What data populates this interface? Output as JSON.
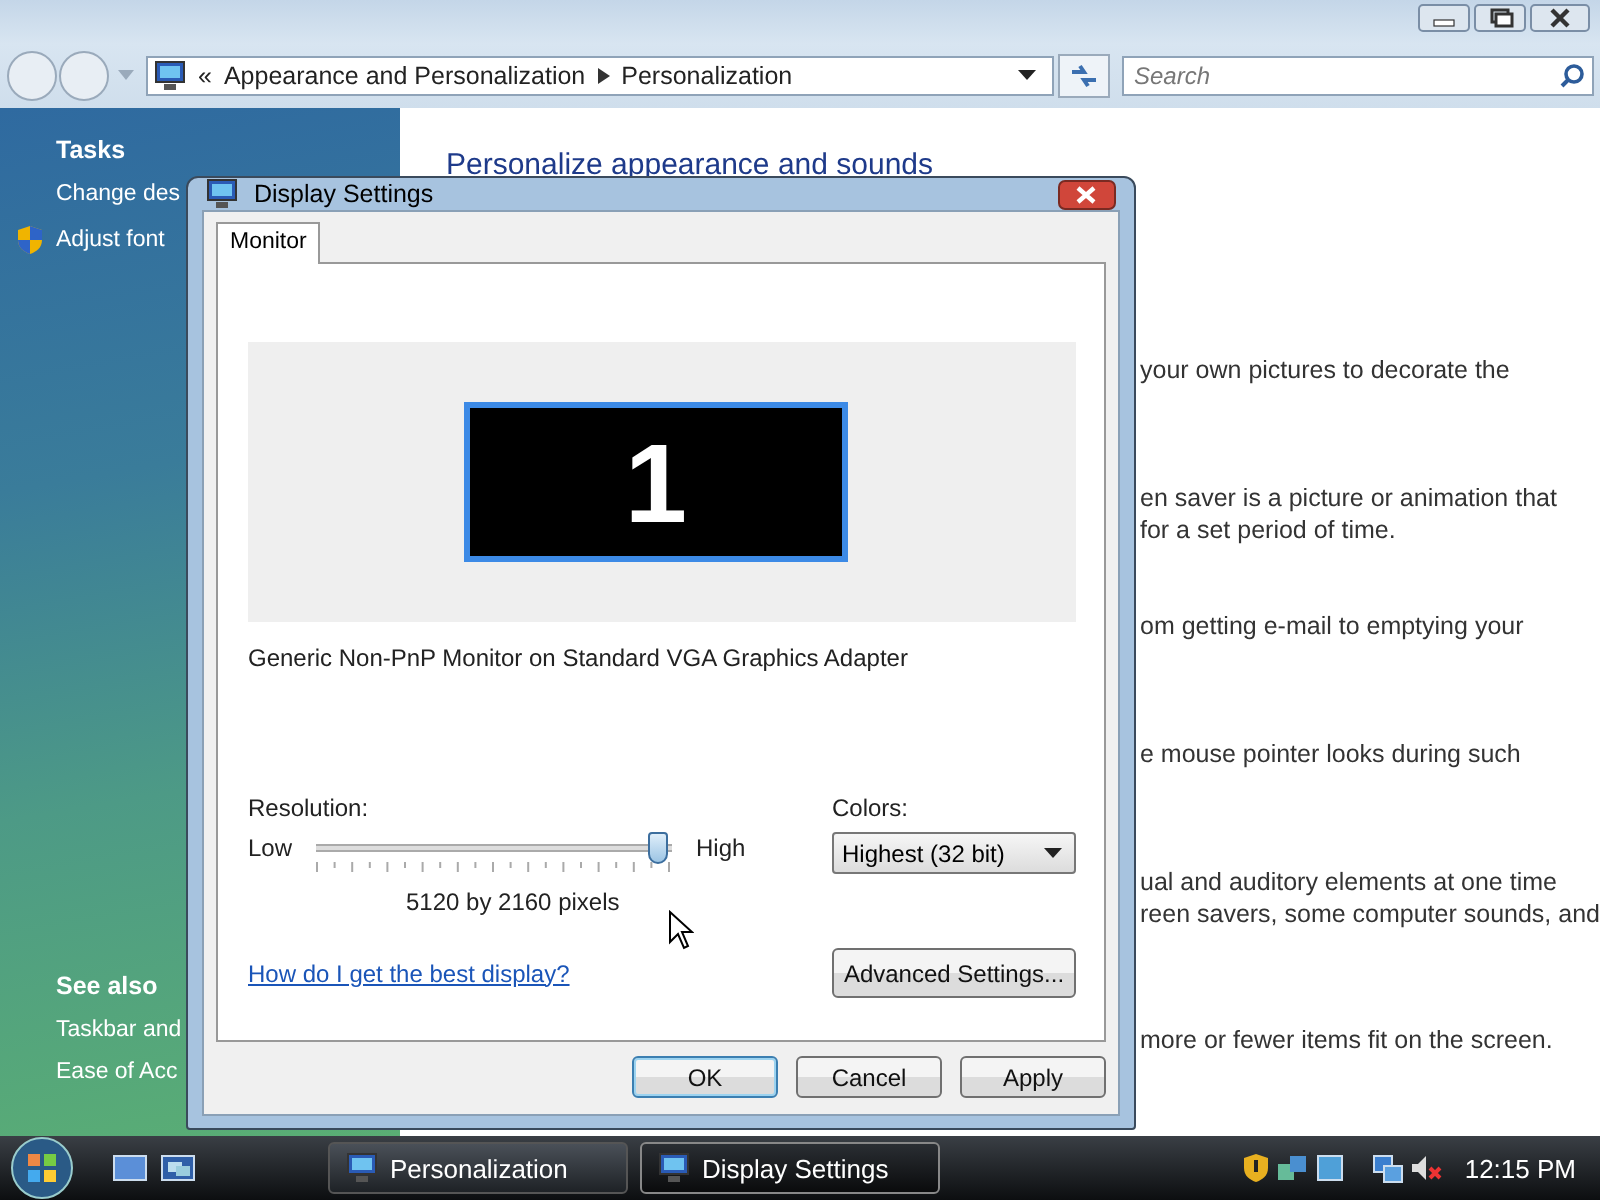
{
  "explorer": {
    "address": {
      "prefix": "«",
      "segments": [
        "Appearance and Personalization",
        "Personalization"
      ]
    },
    "search": {
      "placeholder": "Search"
    }
  },
  "sidebar": {
    "sections": [
      {
        "title": "Tasks",
        "items": [
          {
            "label": "Change des",
            "shield": false
          },
          {
            "label": "Adjust font",
            "shield": true
          }
        ]
      },
      {
        "title": "See also",
        "items": [
          {
            "label": "Taskbar and",
            "shield": false
          },
          {
            "label": "Ease of Acc",
            "shield": false
          }
        ]
      }
    ]
  },
  "content": {
    "heading": "Personalize appearance and sounds",
    "paragraphs": [
      [
        "your own pictures to decorate the"
      ],
      [
        "en saver is a picture or animation that",
        "for a set period of time."
      ],
      [
        "om getting e-mail to emptying your"
      ],
      [
        "e mouse pointer looks during such"
      ],
      [
        "ual and auditory elements at one time",
        "reen savers, some computer sounds, and"
      ],
      [
        "more or fewer items fit on the screen."
      ]
    ]
  },
  "dialog": {
    "title": "Display Settings",
    "tabs": [
      {
        "label": "Monitor",
        "selected": true
      }
    ],
    "monitor_number": "1",
    "monitor_description": "Generic Non-PnP Monitor on Standard VGA Graphics Adapter",
    "resolution": {
      "label": "Resolution:",
      "low": "Low",
      "high": "High",
      "level": 0.96,
      "reading": "5120 by 2160 pixels"
    },
    "colors": {
      "label": "Colors:",
      "value": "Highest (32 bit)"
    },
    "help_link": "How do I get the best display?",
    "advanced_button": "Advanced Settings...",
    "buttons": [
      {
        "label": "OK",
        "default": true
      },
      {
        "label": "Cancel",
        "default": false
      },
      {
        "label": "Apply",
        "default": false
      }
    ]
  },
  "taskbar": {
    "tasks": [
      {
        "label": "Personalization",
        "selected": false
      },
      {
        "label": "Display Settings",
        "selected": true
      }
    ],
    "clock": "12:15 PM"
  }
}
